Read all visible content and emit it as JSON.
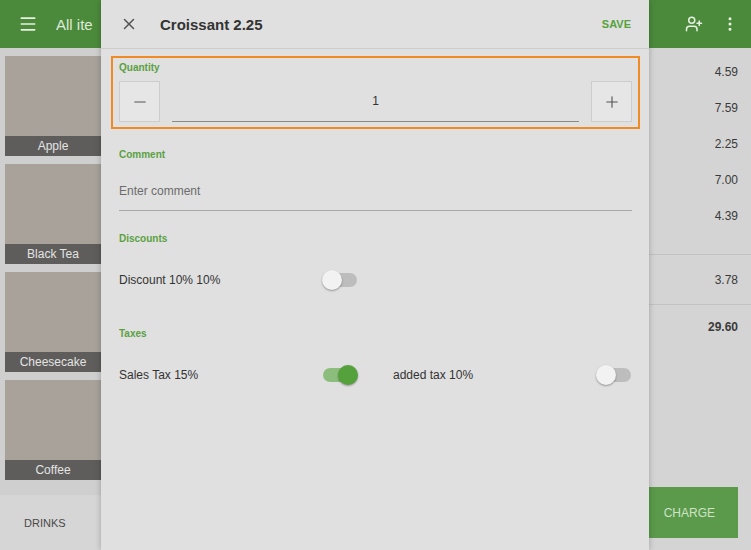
{
  "top_bar": {
    "title": "All ite"
  },
  "items": [
    {
      "name": "Apple"
    },
    {
      "name": "Black Tea"
    },
    {
      "name": "Cheesecake"
    },
    {
      "name": "Coffee"
    }
  ],
  "category_tab": {
    "label": "DRINKS"
  },
  "ticket": {
    "line_prices": [
      "4.59",
      "7.59",
      "2.25",
      "7.00",
      "4.39"
    ],
    "tax": "3.78",
    "total": "29.60"
  },
  "charge_button": "CHARGE",
  "dialog": {
    "title": "Croissant 2.25",
    "save_button": "SAVE",
    "quantity": {
      "label": "Quantity",
      "value": "1",
      "highlighted": true
    },
    "comment": {
      "label": "Comment",
      "placeholder": "Enter comment"
    },
    "discounts": {
      "label": "Discounts",
      "items": [
        {
          "label": "Discount 10% 10%",
          "on": false
        }
      ]
    },
    "taxes": {
      "label": "Taxes",
      "items": [
        {
          "label": "Sales Tax 15%",
          "on": true
        },
        {
          "label": "added tax 10%",
          "on": false
        }
      ]
    }
  }
}
